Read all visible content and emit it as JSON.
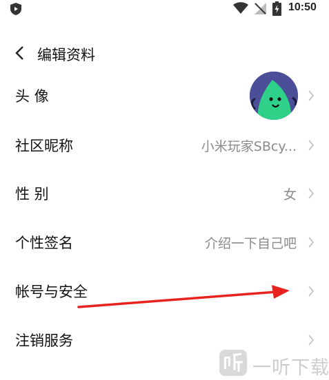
{
  "status_bar": {
    "time": "10:50",
    "icons": [
      "shield-app-icon",
      "wifi-icon",
      "no-sim-icon",
      "battery-charging-icon"
    ]
  },
  "header": {
    "title": "编辑资料",
    "back_icon": "chevron-left-icon"
  },
  "rows": [
    {
      "label": "头 像",
      "value": "",
      "type": "avatar"
    },
    {
      "label": "社区昵称",
      "value": "小米玩家SBcy..."
    },
    {
      "label": "性 别",
      "value": "女"
    },
    {
      "label": "个性签名",
      "value": "介绍一下自己吧"
    },
    {
      "label": "帐号与安全",
      "value": ""
    },
    {
      "label": "注销服务",
      "value": ""
    }
  ],
  "annotation": {
    "color": "#e8231f",
    "icon": "red-arrow-pointer"
  },
  "watermark": {
    "text": "一听下载"
  },
  "colors": {
    "avatar_bg": "#4a4f97",
    "avatar_face": "#2fd189",
    "value_text": "#8a8a8a",
    "chevron": "#c4c4c4"
  }
}
